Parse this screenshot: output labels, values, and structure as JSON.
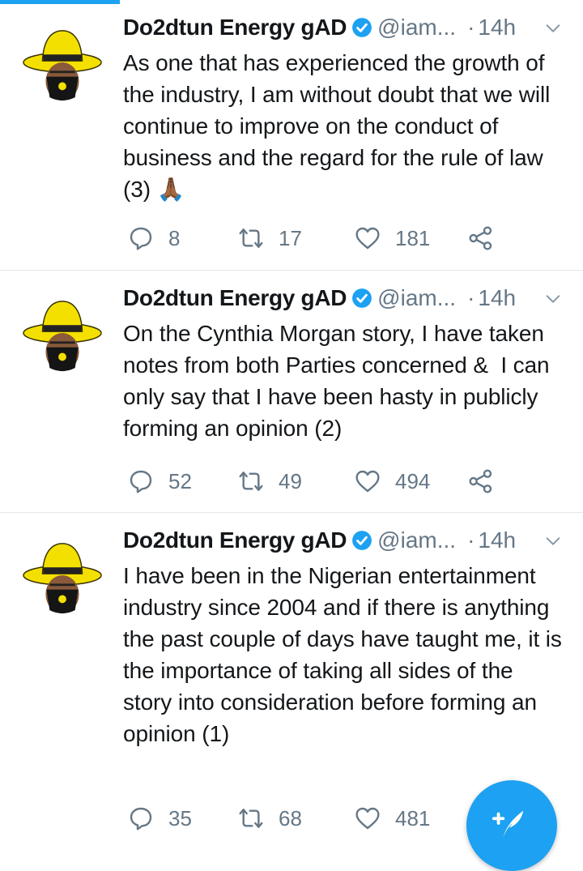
{
  "tweets": [
    {
      "name": "Do2dtun Energy gAD",
      "handle": "@iam...",
      "dot": "·",
      "time": "14h",
      "text": "As one that has experienced the growth of the industry, I am without doubt that we will continue to improve on the conduct of business and the regard for the rule of law (3) 🙏🏾",
      "replies": "8",
      "retweets": "17",
      "likes": "181"
    },
    {
      "name": "Do2dtun Energy gAD",
      "handle": "@iam...",
      "dot": "·",
      "time": "14h",
      "text": "On the Cynthia Morgan story, I have taken notes from both Parties concerned &  I can only say that I have been hasty in publicly forming an opinion (2)",
      "replies": "52",
      "retweets": "49",
      "likes": "494"
    },
    {
      "name": "Do2dtun Energy gAD",
      "handle": "@iam...",
      "dot": "·",
      "time": "14h",
      "text": "I have been in the Nigerian entertainment industry since 2004 and if there is anything the past couple of days have taught me, it is the importance of taking all sides of the story into consideration before forming an opinion (1)",
      "replies": "35",
      "retweets": "68",
      "likes": "481"
    }
  ],
  "colors": {
    "accent": "#1da1f2",
    "secondary_text": "#657786",
    "divider": "#e1e8ed"
  },
  "icons": {
    "reply": "comment-icon",
    "retweet": "retweet-icon",
    "like": "heart-icon",
    "share": "share-icon",
    "verified": "verified-badge-icon",
    "more": "chevron-down-icon",
    "compose": "compose-tweet-icon"
  }
}
